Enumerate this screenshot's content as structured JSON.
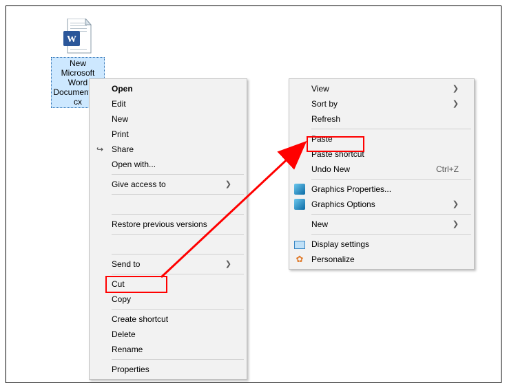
{
  "file": {
    "label": "New Microsoft Word Document.docx",
    "icon": "word-document"
  },
  "menu1": {
    "items": [
      {
        "label": "Open",
        "bold": true
      },
      {
        "label": "Edit"
      },
      {
        "label": "New"
      },
      {
        "label": "Print"
      },
      {
        "label": "Share",
        "icon": "share"
      },
      {
        "label": "Open with...",
        "submenu": false
      },
      {
        "sep": true
      },
      {
        "label": "Give access to",
        "submenu": true
      },
      {
        "sep": true
      },
      {
        "blank": true
      },
      {
        "sep": true
      },
      {
        "label": "Restore previous versions"
      },
      {
        "sep": true
      },
      {
        "blank": true
      },
      {
        "sep": true
      },
      {
        "label": "Send to",
        "submenu": true
      },
      {
        "sep": true
      },
      {
        "label": "Cut"
      },
      {
        "label": "Copy"
      },
      {
        "sep": true
      },
      {
        "label": "Create shortcut"
      },
      {
        "label": "Delete"
      },
      {
        "label": "Rename"
      },
      {
        "sep": true
      },
      {
        "label": "Properties"
      }
    ]
  },
  "menu2": {
    "items": [
      {
        "label": "View",
        "submenu": true
      },
      {
        "label": "Sort by",
        "submenu": true
      },
      {
        "label": "Refresh"
      },
      {
        "sep": true
      },
      {
        "label": "Paste"
      },
      {
        "label": "Paste shortcut"
      },
      {
        "label": "Undo New",
        "shortcut": "Ctrl+Z"
      },
      {
        "sep": true
      },
      {
        "label": "Graphics Properties...",
        "icon": "intel"
      },
      {
        "label": "Graphics Options",
        "icon": "intel",
        "submenu": true
      },
      {
        "sep": true
      },
      {
        "label": "New",
        "submenu": true
      },
      {
        "sep": true
      },
      {
        "label": "Display settings",
        "icon": "monitor"
      },
      {
        "label": "Personalize",
        "icon": "personalize"
      }
    ]
  },
  "annotations": {
    "highlight1": "Cut",
    "highlight2": "Paste"
  }
}
